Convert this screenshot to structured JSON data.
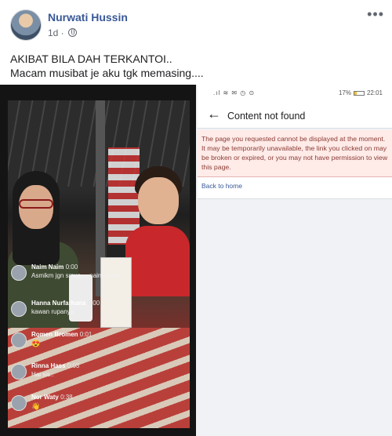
{
  "post": {
    "author": "Nurwati Hussin",
    "time": "1d ·",
    "caption_line1": "AKIBAT BILA DAH TERKANTOI..",
    "caption_line2": "Macam musibat je aku tgk memasing...."
  },
  "left_screenshot": {
    "comments": [
      {
        "name": "Naim Naim",
        "time": "0:00",
        "text": "Asmikm jgn smua ... naim la kot",
        "emoji": ""
      },
      {
        "name": "Hanna Nurfarhana",
        "time": "0:00",
        "text": "kawan rupanya",
        "emoji": ""
      },
      {
        "name": "Romen Bromen",
        "time": "0:01",
        "text": "",
        "emoji": "😍"
      },
      {
        "name": "Rinna Hass",
        "time": "0:03",
        "text": "Hai sis..",
        "emoji": ""
      },
      {
        "name": "Nor Waty",
        "time": "0:38",
        "text": "",
        "emoji": "👋"
      }
    ]
  },
  "right_screenshot": {
    "status_battery": "17%",
    "status_time": "22:01",
    "title": "Content not found",
    "notice": "The page you requested cannot be displayed at the moment. It may be temporarily unavailable, the link you clicked on may be broken or expired, or you may not have permission to view this page.",
    "back_link": "Back to home"
  },
  "icons": {
    "globe": "globe-icon",
    "more": "more-icon",
    "back": "back-arrow-icon"
  }
}
